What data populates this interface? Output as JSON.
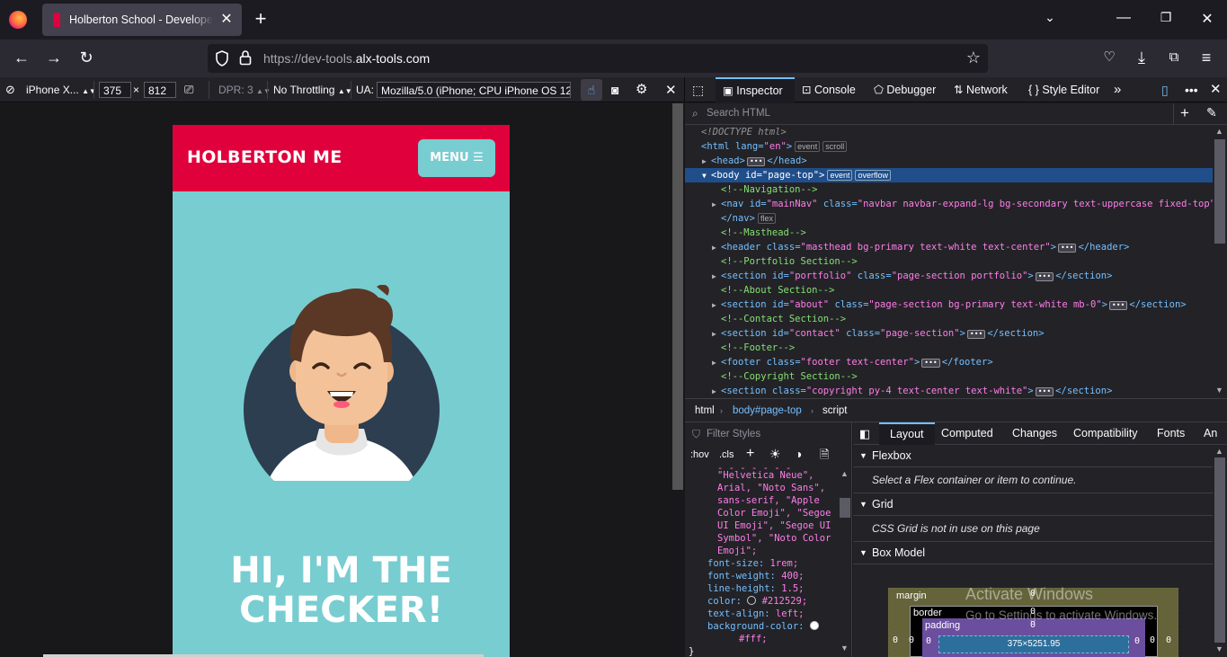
{
  "browser": {
    "tab_title": "Holberton School - Developer t",
    "url_prefix": "https://dev-tools.",
    "url_domain": "alx-tools.com"
  },
  "rdm": {
    "device": "iPhone X...",
    "width": "375",
    "times": "×",
    "height": "812",
    "dpr": "DPR: 3",
    "throttling": "No Throttling",
    "ua_label": "UA:",
    "ua_value": "Mozilla/5.0 (iPhone; CPU iPhone OS 12_"
  },
  "site": {
    "brand": "HOLBERTON ME",
    "menu_label": "MENU",
    "hero_line1": "HI, I'M THE",
    "hero_line2": "CHECKER!"
  },
  "devtools": {
    "tabs": {
      "inspector": "Inspector",
      "console": "Console",
      "debugger": "Debugger",
      "network": "Network",
      "style_editor": "Style Editor"
    },
    "search_placeholder": "Search HTML",
    "markup": {
      "doctype": "<!DOCTYPE html>",
      "html_open": "<html",
      "html_lang_attr": "lang=",
      "html_lang_val": "\"en\"",
      "close_gt": ">",
      "badge_event": "event",
      "badge_scroll": "scroll",
      "badge_overflow": "overflow",
      "badge_flex": "flex",
      "head_open": "<head>",
      "head_close": "</head>",
      "body_open": "<body",
      "body_id_attr": "id=",
      "body_id_val": "\"page-top\"",
      "c_nav": "<!--Navigation-->",
      "nav_open": "<nav",
      "nav_id_attr": "id=",
      "nav_id_val": "\"mainNav\"",
      "class_attr": "class=",
      "nav_class_val": "\"navbar navbar-expand-lg bg-secondary text-uppercase fixed-top\"",
      "nav_close": "</nav>",
      "c_masthead": "<!--Masthead-->",
      "header_open": "<header",
      "header_class_val": "\"masthead bg-primary text-white text-center\"",
      "header_close": "</header>",
      "c_portfolio": "<!--Portfolio Section-->",
      "section_open": "<section",
      "id_attr": "id=",
      "portfolio_id_val": "\"portfolio\"",
      "portfolio_class_val": "\"page-section portfolio\"",
      "section_close": "</section>",
      "c_about": "<!--About Section-->",
      "about_id_val": "\"about\"",
      "about_class_val": "\"page-section bg-primary text-white mb-0\"",
      "c_contact": "<!--Contact Section-->",
      "contact_id_val": "\"contact\"",
      "contact_class_val": "\"page-section\"",
      "c_footer": "<!--Footer-->",
      "footer_open": "<footer",
      "footer_class_val": "\"footer text-center\"",
      "footer_close": "</footer>",
      "c_copyright": "<!--Copyright Section-->",
      "copyright_class_val": "\"copyright py-4 text-center text-white\""
    },
    "breadcrumbs": [
      "html",
      "body#page-top",
      "script"
    ],
    "rules": {
      "filter_placeholder": "Filter Styles",
      "hov": ":hov",
      "cls": ".cls",
      "font_lines": [
        "\"Helvetica Neue\",",
        "Arial, \"Noto Sans\",",
        "sans-serif, \"Apple",
        "Color Emoji\", \"Segoe",
        "UI Emoji\", \"Segoe UI",
        "Symbol\", \"Noto Color",
        "Emoji\";"
      ],
      "font_size_prop": "font-size:",
      "font_size_val": "1rem;",
      "font_weight_prop": "font-weight:",
      "font_weight_val": "400;",
      "line_height_prop": "line-height:",
      "line_height_val": "1.5;",
      "color_prop": "color:",
      "color_val": "#212529;",
      "text_align_prop": "text-align:",
      "text_align_val": "left;",
      "bg_prop": "background-color:",
      "bg_val": "#fff;",
      "close_brace": "}"
    },
    "layout_tabs": [
      "Layout",
      "Computed",
      "Changes",
      "Compatibility",
      "Fonts",
      "An"
    ],
    "flexbox_title": "Flexbox",
    "flexbox_msg": "Select a Flex container or item to continue.",
    "grid_title": "Grid",
    "grid_msg": "CSS Grid is not in use on this page",
    "boxmodel_title": "Box Model",
    "boxmodel": {
      "margin_label": "margin",
      "border_label": "border",
      "padding_label": "padding",
      "content_size": "375×5251.95",
      "zero": "0"
    }
  },
  "watermark": {
    "line1": "Activate Windows",
    "line2": "Go to Settings to activate Windows."
  },
  "colors": {
    "site_nav": "#e0003c",
    "site_bg": "#78cdd1",
    "selected_row": "#204e8a"
  }
}
